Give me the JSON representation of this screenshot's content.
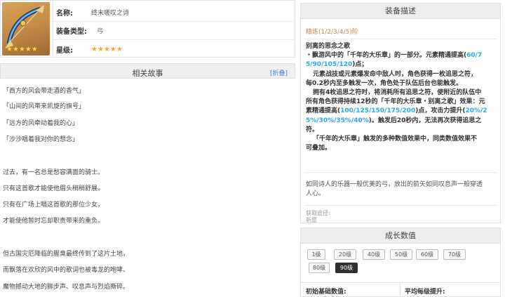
{
  "weapon": {
    "name_label": "名称:",
    "name_value": "终末嗟叹之诗",
    "type_label": "装备类型:",
    "type_value": "弓",
    "rarity_label": "星级:",
    "rarity_stars": "★★★★★",
    "thumb_stars": "★★★★★",
    "thumb_icon": "bow-icon"
  },
  "story": {
    "title": "相关故事",
    "fold_label": "[折叠]",
    "lines": [
      "「西方的风会带走酒的香气」",
      "「山间的风带来凯旋的旗号」",
      "「远方的风牵动着我的心」",
      "「沙沙唱着我对你的想念」",
      "过去，有一名总是愁容满面的骑士。",
      "只有这首歌才能使他眉头稍稍舒展。",
      "只有在广场上唱这首歌的那位少女，",
      "才能使他暂时忘却职责带来的重负。",
      "但古国灾厄降临的腥臭最终传到了这片土地，",
      "而飘落在欢欣的风中的歌词也被毒龙的咆哮、",
      "魔物撼动大地的脚步声、叹息声与烈焰撕碎。"
    ]
  },
  "desc": {
    "title": "装备描述",
    "refine": "精炼(1/2/3/4/5)阶",
    "effect_title": "别离的思念之歌",
    "p1a": "・飘游风中的「千年的大乐章」的一部分。元素精通提高(",
    "p1b": "60/7",
    "p1c": "5/90/105/120",
    "p1d": ")点；",
    "p2a": "元素战技或元素爆发命中敌人时，角色获得一枚追思之符，",
    "p2b": "每0.2秒内至多触发一次，角色处于队伍后台也能触发。",
    "p3a": "拥有4枚追思之符时，将消耗所有追思之符，使附近的队伍中",
    "p3b": "所有角色获得持续12秒的「千年的大乐章・别离之歌」效果：元",
    "p3c": "素精通提高(",
    "p3d": "100/125/150/175/200",
    "p3e": ")点，攻击力提升(",
    "p3f": "20%/2",
    "p3g": "5%/30%/35%/40%",
    "p3h": ")。触发后20秒内，无法再次获得追思之",
    "p3i": "符。",
    "p4a": "「千年的大乐章」触发的多种数值效果中，同类数值效果不",
    "p4b": "可叠加。",
    "flavor_a": "如同诗人的乐器一般优美的弓，放出的箭矢如同叹息声一般穿透",
    "flavor_b": "人心。",
    "source_label": "获取途径:",
    "source_value": "祈愿"
  },
  "growth": {
    "title": "成长数值",
    "levels": [
      "1级",
      "20级",
      "40级",
      "50级",
      "60级",
      "70级",
      "80级",
      "90级"
    ],
    "active_level": "90级",
    "base_label": "初始基础数值:",
    "per_level_label": "平均每级提升:"
  },
  "colors": {
    "accent_blue": "#2fa7e4",
    "refine_tan": "#c18a55",
    "star_gold": "#f5a623"
  }
}
